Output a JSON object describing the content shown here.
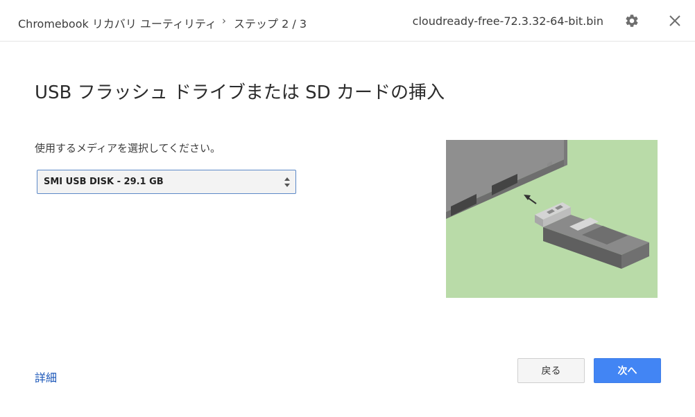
{
  "header": {
    "app_title": "Chromebook リカバリ ユーティリティ",
    "breadcrumb_separator": "›",
    "step": "ステップ 2 / 3",
    "file_name": "cloudready-free-72.3.32-64-bit.bin",
    "settings_icon": "gear-icon",
    "close_icon": "close-icon"
  },
  "main": {
    "title": "USB フラッシュ ドライブまたは SD カードの挿入",
    "prompt": "使用するメディアを選択してください。",
    "media_select": {
      "selected": "SMI USB DISK - 29.1 GB"
    },
    "illustration": {
      "icon": "usb-insert-illustration",
      "background_color": "#b9dba8"
    }
  },
  "footer": {
    "details_link": "詳細",
    "back_button": "戻る",
    "next_button": "次へ"
  },
  "colors": {
    "accent": "#4285f4",
    "link": "#1a56b8"
  }
}
